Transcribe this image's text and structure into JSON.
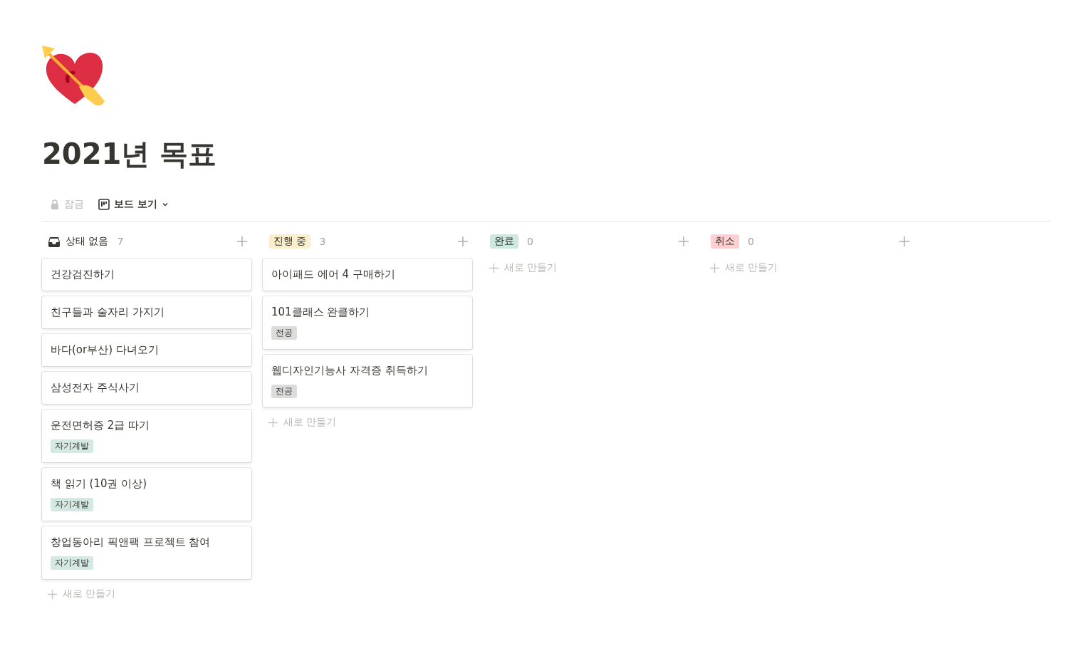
{
  "page": {
    "title": "2021년 목표"
  },
  "toolbar": {
    "lock_label": "잠금",
    "view_label": "보드 보기"
  },
  "columns": [
    {
      "kind": "no-status",
      "label": "상태 없음",
      "count": "7",
      "new_label": "새로 만들기",
      "cards": [
        {
          "title": "건강검진하기"
        },
        {
          "title": "친구들과 술자리 가지기"
        },
        {
          "title": "바다(or부산) 다녀오기"
        },
        {
          "title": "삼성전자 주식사기"
        },
        {
          "title": "운전면허증 2급 따기",
          "tags": [
            {
              "label": "자기계발",
              "color": "#d3e9e3"
            }
          ]
        },
        {
          "title": "책 읽기 (10권 이상)",
          "tags": [
            {
              "label": "자기계발",
              "color": "#d3e9e3"
            }
          ]
        },
        {
          "title": "창업동아리 픽앤팩 프로젝트 참여",
          "tags": [
            {
              "label": "자기계발",
              "color": "#d3e9e3"
            }
          ]
        }
      ]
    },
    {
      "kind": "status",
      "label": "진행 중",
      "color": "#fbeecc",
      "count": "3",
      "new_label": "새로 만들기",
      "cards": [
        {
          "title": "아이패드 에어 4 구매하기"
        },
        {
          "title": "101클래스 완클하기",
          "tags": [
            {
              "label": "전공",
              "color": "#dcdcdb"
            }
          ]
        },
        {
          "title": "웹디자인기능사 자격증 취득하기",
          "tags": [
            {
              "label": "전공",
              "color": "#dcdcdb"
            }
          ]
        }
      ]
    },
    {
      "kind": "status",
      "label": "완료",
      "color": "#cde7e1",
      "count": "0",
      "new_label": "새로 만들기"
    },
    {
      "kind": "status",
      "label": "취소",
      "color": "#ffcfd1",
      "count": "0",
      "new_label": "새로 만들기"
    }
  ]
}
